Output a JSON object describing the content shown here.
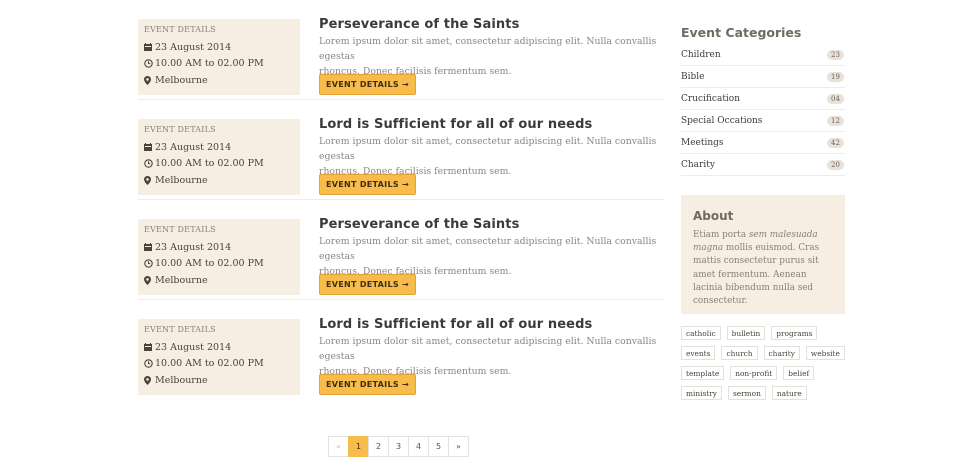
{
  "events": [
    {
      "box_heading": "EVENT DETAILS",
      "date": "23 August 2014",
      "time": "10.00 AM to 02.00 PM",
      "location": "Melbourne",
      "title": "Perseverance of the Saints",
      "desc_line1": "Lorem ipsum dolor sit amet, consectetur adipiscing elit. Nulla convallis egestas",
      "desc_line2": "rhoncus. Donec facilisis fermentum sem.",
      "button": "EVENT DETAILS →"
    },
    {
      "box_heading": "EVENT DETAILS",
      "date": "23 August 2014",
      "time": "10.00 AM to 02.00 PM",
      "location": "Melbourne",
      "title": "Lord is Sufficient for all of our needs",
      "desc_line1": "Lorem ipsum dolor sit amet, consectetur adipiscing elit. Nulla convallis egestas",
      "desc_line2": "rhoncus. Donec facilisis fermentum sem.",
      "button": "EVENT DETAILS →"
    },
    {
      "box_heading": "EVENT DETAILS",
      "date": "23 August 2014",
      "time": "10.00 AM to 02.00 PM",
      "location": "Melbourne",
      "title": "Perseverance of the Saints",
      "desc_line1": "Lorem ipsum dolor sit amet, consectetur adipiscing elit. Nulla convallis egestas",
      "desc_line2": "rhoncus. Donec facilisis fermentum sem.",
      "button": "EVENT DETAILS →"
    },
    {
      "box_heading": "EVENT DETAILS",
      "date": "23 August 2014",
      "time": "10.00 AM to 02.00 PM",
      "location": "Melbourne",
      "title": "Lord is Sufficient for all of our needs",
      "desc_line1": "Lorem ipsum dolor sit amet, consectetur adipiscing elit. Nulla convallis egestas",
      "desc_line2": "rhoncus. Donec facilisis fermentum sem.",
      "button": "EVENT DETAILS →"
    }
  ],
  "pagination": {
    "prev": "«",
    "pages": [
      "1",
      "2",
      "3",
      "4",
      "5"
    ],
    "active_page": "1",
    "next": "»"
  },
  "sidebar": {
    "categories_title": "Event Categories",
    "categories": [
      {
        "label": "Children",
        "count": "23"
      },
      {
        "label": "Bible",
        "count": "19"
      },
      {
        "label": "Crucification",
        "count": "04"
      },
      {
        "label": "Special Occations",
        "count": "12"
      },
      {
        "label": "Meetings",
        "count": "42"
      },
      {
        "label": "Charity",
        "count": "20"
      }
    ],
    "about_title": "About",
    "about_text_1": "Etiam porta ",
    "about_text_em": "sem malesuada magna",
    "about_text_2": " mollis euismod. Cras mattis consectetur purus sit amet fermentum. Aenean lacinia bibendum nulla sed consectetur.",
    "tags": [
      "catholic",
      "bulletin",
      "programs",
      "events",
      "church",
      "charity",
      "website",
      "template",
      "non-profit",
      "belief",
      "ministry",
      "sermon",
      "nature"
    ]
  },
  "icons": {
    "date": "calendar-icon",
    "time": "clock-icon",
    "location": "map-marker-icon"
  },
  "colors": {
    "accent": "#f7bc4a",
    "box_bg": "#f6eee2",
    "text": "#3b3b3b",
    "muted": "#8a8580"
  }
}
